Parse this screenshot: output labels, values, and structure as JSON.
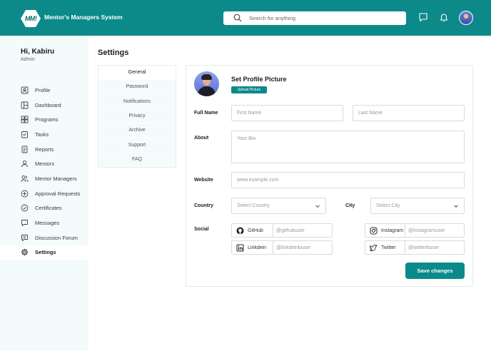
{
  "header": {
    "logo_text": "MM!",
    "title": "Mentor's Managers System",
    "search_placeholder": "Search for anything",
    "icons": [
      "search-icon",
      "chat-icon",
      "bell-icon"
    ]
  },
  "user": {
    "greeting": "Hi, Kabiru",
    "role": "Admin"
  },
  "sidebar": {
    "items": [
      {
        "label": "Profile",
        "icon": "profile-icon"
      },
      {
        "label": "Dashboard",
        "icon": "dashboard-icon"
      },
      {
        "label": "Programs",
        "icon": "programs-icon"
      },
      {
        "label": "Tasks",
        "icon": "tasks-icon"
      },
      {
        "label": "Reports",
        "icon": "reports-icon"
      },
      {
        "label": "Mentors",
        "icon": "mentors-icon"
      },
      {
        "label": "Mentor Managers",
        "icon": "mentor-managers-icon"
      },
      {
        "label": "Approval Requests",
        "icon": "approval-icon"
      },
      {
        "label": "Certificates",
        "icon": "certificate-icon"
      },
      {
        "label": "Messages",
        "icon": "messages-icon"
      },
      {
        "label": "Discussion Forum",
        "icon": "forum-icon"
      },
      {
        "label": "Settings",
        "icon": "gear-icon",
        "active": true
      }
    ]
  },
  "page": {
    "title": "Settings"
  },
  "tabs": [
    "General",
    "Password",
    "Notifications",
    "Privacy",
    "Archive",
    "Support",
    "FAQ"
  ],
  "form": {
    "set_picture_title": "Set Profile Picture",
    "upload_label": "Upload Picture",
    "fullname_label": "Full Name",
    "first_name_placeholder": "First Name",
    "last_name_placeholder": "Last Name",
    "about_label": "About",
    "bio_placeholder": "Your Bio",
    "website_label": "Website",
    "website_placeholder": "www.example.com",
    "country_label": "Country",
    "country_placeholder": "Select Country",
    "city_label": "City",
    "city_placeholder": "Select City",
    "social_label": "Social",
    "social": {
      "github": {
        "name": "GitHub",
        "handle": "@githubuser"
      },
      "instagram": {
        "name": "Instagram",
        "handle": "@instagramuser"
      },
      "linkedin": {
        "name": "Linkdein",
        "handle": "@linkdeinbuser"
      },
      "twitter": {
        "name": "Twitter",
        "handle": "@twitterbuser"
      }
    },
    "save_label": "Save changes"
  },
  "colors": {
    "primary": "#0c8a8a",
    "sidebar_bg": "#f3fbfb"
  }
}
